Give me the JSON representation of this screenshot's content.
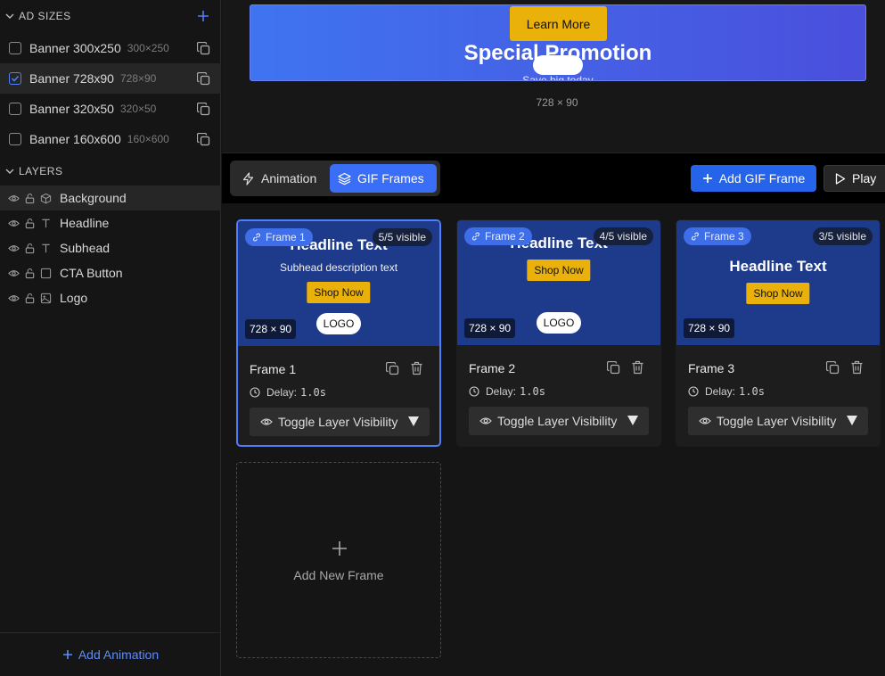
{
  "sidebar": {
    "ad_sizes": {
      "title": "AD SIZES",
      "items": [
        {
          "label": "Banner 300x250",
          "dim": "300×250",
          "checked": false
        },
        {
          "label": "Banner 728x90",
          "dim": "728×90",
          "checked": true
        },
        {
          "label": "Banner 320x50",
          "dim": "320×50",
          "checked": false
        },
        {
          "label": "Banner 160x600",
          "dim": "160×600",
          "checked": false
        }
      ]
    },
    "layers": {
      "title": "LAYERS",
      "items": [
        {
          "label": "Background",
          "icon": "box-icon"
        },
        {
          "label": "Headline",
          "icon": "text-icon"
        },
        {
          "label": "Subhead",
          "icon": "text-icon"
        },
        {
          "label": "CTA Button",
          "icon": "button-icon"
        },
        {
          "label": "Logo",
          "icon": "image-icon"
        }
      ]
    },
    "add_animation": "Add Animation"
  },
  "preview": {
    "cta": "Learn More",
    "headline": "Special Promotion",
    "subhead": "Save big today",
    "dimensions": "728 × 90"
  },
  "toolbar": {
    "animation_tab": "Animation",
    "gif_frames_tab": "GIF Frames",
    "add_gif_frame": "Add GIF Frame",
    "play": "Play"
  },
  "frames": [
    {
      "badge": "Frame 1",
      "visible": "5/5 visible",
      "headline": "Headline Text",
      "subhead": "Subhead description text",
      "cta": "Shop Now",
      "logo": "LOGO",
      "dim": "728 × 90",
      "name": "Frame 1",
      "delay_label": "Delay:",
      "delay": "1.0s",
      "toggle": "Toggle Layer Visibility"
    },
    {
      "badge": "Frame 2",
      "visible": "4/5 visible",
      "headline": "Headline Text",
      "cta": "Shop Now",
      "logo": "LOGO",
      "dim": "728 × 90",
      "name": "Frame 2",
      "delay_label": "Delay:",
      "delay": "1.0s",
      "toggle": "Toggle Layer Visibility"
    },
    {
      "badge": "Frame 3",
      "visible": "3/5 visible",
      "headline": "Headline Text",
      "cta": "Shop Now",
      "dim": "728 × 90",
      "name": "Frame 3",
      "delay_label": "Delay:",
      "delay": "1.0s",
      "toggle": "Toggle Layer Visibility"
    }
  ],
  "add_new_frame": "Add New Frame",
  "colors": {
    "accent": "#2563eb",
    "cta_yellow": "#e9b10a",
    "frame_bg": "#1e3a8a"
  }
}
